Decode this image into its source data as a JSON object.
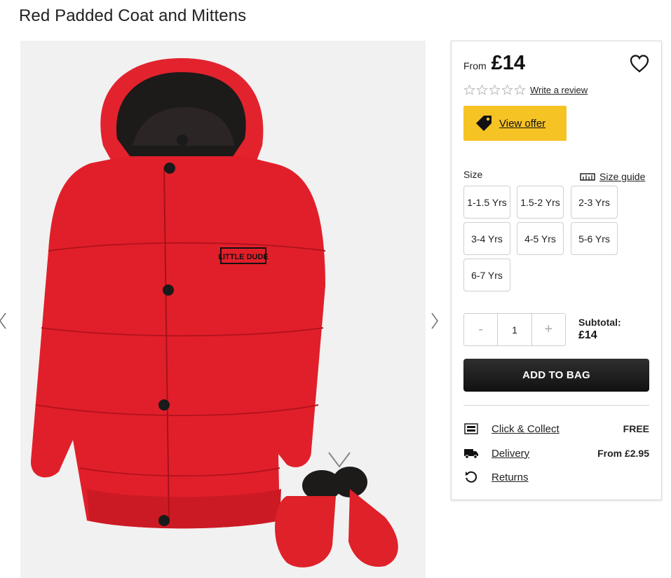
{
  "product": {
    "title": "Red Padded Coat and Mittens",
    "image_badge": "LITTLE DUDE"
  },
  "price": {
    "from_label": "From",
    "value": "£14"
  },
  "rating": {
    "stars": 0,
    "max_stars": 5,
    "review_link": "Write a review"
  },
  "offer": {
    "label": "View offer",
    "color": "#f6c325"
  },
  "sizes": {
    "label": "Size",
    "guide_label": "Size guide",
    "options": [
      "1-1.5 Yrs",
      "1.5-2 Yrs",
      "2-3 Yrs",
      "3-4 Yrs",
      "4-5 Yrs",
      "5-6 Yrs",
      "6-7 Yrs"
    ]
  },
  "quantity": {
    "minus": "-",
    "value": "1",
    "plus": "+"
  },
  "subtotal": {
    "label": "Subtotal:",
    "value": "£14"
  },
  "add_to_bag": "ADD TO BAG",
  "services": [
    {
      "icon": "click-collect-icon",
      "label": "Click & Collect",
      "value": "FREE"
    },
    {
      "icon": "delivery-truck-icon",
      "label": "Delivery",
      "value": "From £2.95"
    },
    {
      "icon": "returns-icon",
      "label": "Returns",
      "value": ""
    }
  ]
}
